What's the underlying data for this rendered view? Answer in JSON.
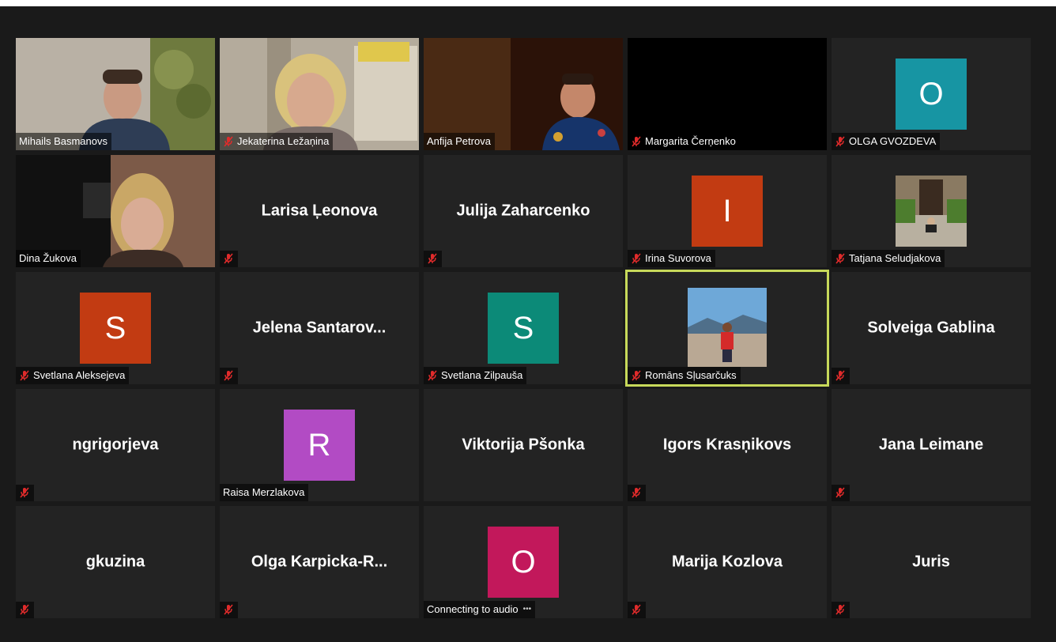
{
  "participants": [
    {
      "name": "Mihails Basmanovs",
      "muted": false,
      "video": "v1"
    },
    {
      "name": "Jekaterina Ležaņina",
      "muted": true,
      "video": "v2"
    },
    {
      "name": "Anfija Petrova",
      "muted": false,
      "video": "v3"
    },
    {
      "name": "Margarita Čerņenko",
      "muted": true,
      "video": "black"
    },
    {
      "name": "OLGA GVOZDEVA",
      "muted": true,
      "avatar_letter": "O",
      "avatar_color": "#1795a3"
    },
    {
      "name": "Dina Žukova",
      "muted": false,
      "video": "v6"
    },
    {
      "name": "Larisa Ļeonova",
      "muted": true
    },
    {
      "name": "Julija Zaharcenko",
      "muted": true
    },
    {
      "name": "Irina Suvorova",
      "muted": true,
      "avatar_letter": "I",
      "avatar_color": "#c23b12"
    },
    {
      "name": "Tatjana Seludjakova",
      "muted": true,
      "photo": "stairs"
    },
    {
      "name": "Svetlana Aleksejeva",
      "muted": true,
      "avatar_letter": "S",
      "avatar_color": "#c23b12"
    },
    {
      "name": "Jelena  Santarov...",
      "muted": true
    },
    {
      "name": "Svetlana Zilpauša",
      "muted": true,
      "avatar_letter": "S",
      "avatar_color": "#0c8a78"
    },
    {
      "name": "Romāns Sļusarčuks",
      "muted": true,
      "photo": "mountain",
      "active": true
    },
    {
      "name": "Solveiga Gablina",
      "muted": true
    },
    {
      "name": "ngrigorjeva",
      "muted": true
    },
    {
      "name": "Raisa Merzlakova",
      "muted": false,
      "avatar_letter": "R",
      "avatar_color": "#b24bc4"
    },
    {
      "name": "Viktorija Pšonka",
      "muted": false
    },
    {
      "name": "Igors Krasņikovs",
      "muted": true
    },
    {
      "name": "Jana Leimane",
      "muted": true
    },
    {
      "name": "gkuzina",
      "muted": true
    },
    {
      "name": "Olga  Karpicka-R...",
      "muted": true
    },
    {
      "name": "Connecting to audio",
      "muted": false,
      "avatar_letter": "O",
      "avatar_color": "#c2185b",
      "connecting": true
    },
    {
      "name": "Marija Kozlova",
      "muted": true
    },
    {
      "name": "Juris",
      "muted": true
    }
  ],
  "colors": {
    "active_border": "#c7d95a",
    "tile_bg": "#232323",
    "mute_red": "#e02b2b"
  },
  "icons": {
    "mute": "microphone-muted-icon"
  }
}
